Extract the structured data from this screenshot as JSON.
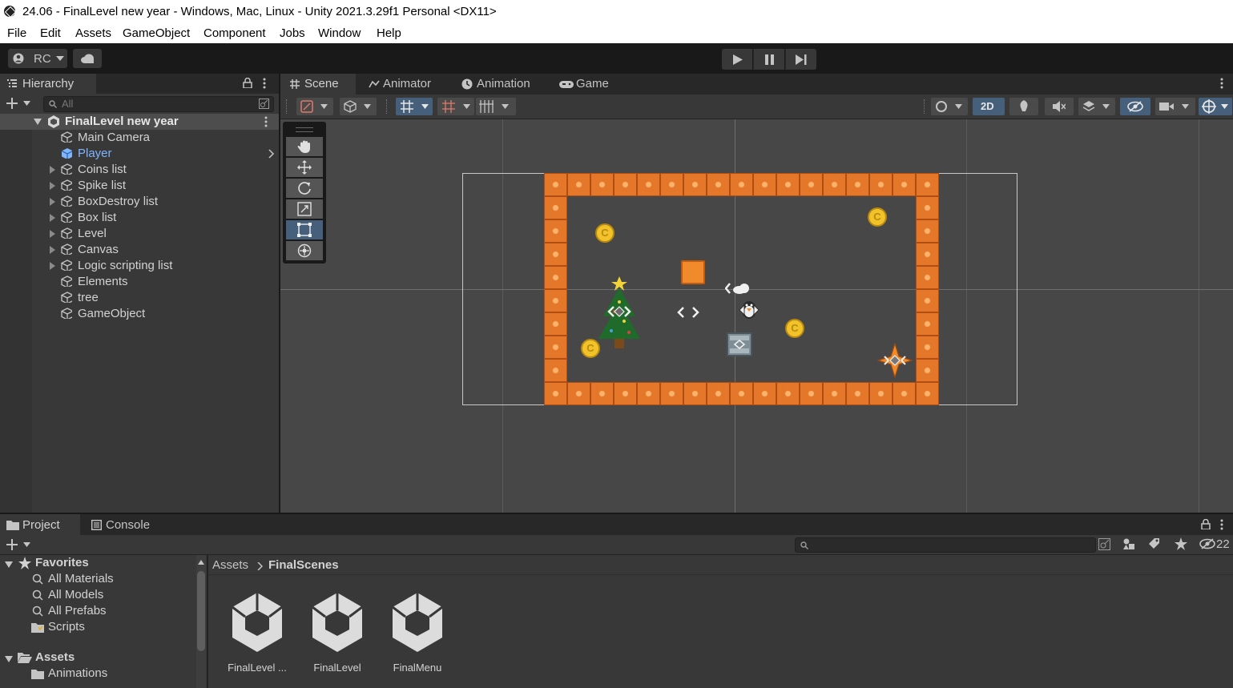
{
  "window": {
    "title": "24.06 - FinalLevel new year - Windows, Mac, Linux - Unity 2021.3.29f1 Personal <DX11>"
  },
  "menu": [
    "File",
    "Edit",
    "Assets",
    "GameObject",
    "Component",
    "Jobs",
    "Window",
    "Help"
  ],
  "toolbar": {
    "account_label": "RC",
    "account_icon": "user-icon",
    "cloud_icon": "cloud-icon",
    "play_icon": "play-icon",
    "pause_icon": "pause-icon",
    "step_icon": "step-icon"
  },
  "hierarchy": {
    "tab_label": "Hierarchy",
    "search_placeholder": "All",
    "scene_name": "FinalLevel new year",
    "items": [
      {
        "label": "Main Camera",
        "expandable": false
      },
      {
        "label": "Player",
        "expandable": false,
        "selected_color": "#7fb4ff"
      },
      {
        "label": "Coins list",
        "expandable": true
      },
      {
        "label": "Spike list",
        "expandable": true
      },
      {
        "label": "BoxDestroy list",
        "expandable": true
      },
      {
        "label": "Box list",
        "expandable": true
      },
      {
        "label": "Level",
        "expandable": true
      },
      {
        "label": "Canvas",
        "expandable": true
      },
      {
        "label": "Logic scripting list",
        "expandable": true
      },
      {
        "label": "Elements",
        "expandable": false
      },
      {
        "label": "tree",
        "expandable": false
      },
      {
        "label": "GameObject",
        "expandable": false
      }
    ]
  },
  "scene": {
    "tabs": [
      {
        "label": "Scene",
        "icon": "grid-icon",
        "active": true
      },
      {
        "label": "Animator",
        "icon": "animator-icon",
        "active": false
      },
      {
        "label": "Animation",
        "icon": "clock-icon",
        "active": false
      },
      {
        "label": "Game",
        "icon": "gamepad-icon",
        "active": false
      }
    ],
    "toggle_2d": "2D",
    "tools": [
      "hand-tool",
      "move-tool",
      "rotate-tool",
      "scale-tool",
      "rect-tool",
      "transform-tool"
    ],
    "active_tool": "rect-tool",
    "coin_glyph": "C"
  },
  "project": {
    "tabs": [
      {
        "label": "Project",
        "icon": "folder-icon",
        "active": true
      },
      {
        "label": "Console",
        "icon": "console-icon",
        "active": false
      }
    ],
    "hidden_count": "22",
    "favorites": {
      "label": "Favorites",
      "items": [
        "All Materials",
        "All Models",
        "All Prefabs",
        "Scripts"
      ]
    },
    "assets_root": {
      "label": "Assets",
      "items": [
        "Animations"
      ]
    },
    "breadcrumb": [
      "Assets",
      "FinalScenes"
    ],
    "files": [
      "FinalLevel ...",
      "FinalLevel",
      "FinalMenu"
    ]
  },
  "colors": {
    "accent_blue": "#46607c",
    "brick": "#e5772a",
    "coin": "#f2c22a",
    "selected_text": "#7fb4ff"
  }
}
